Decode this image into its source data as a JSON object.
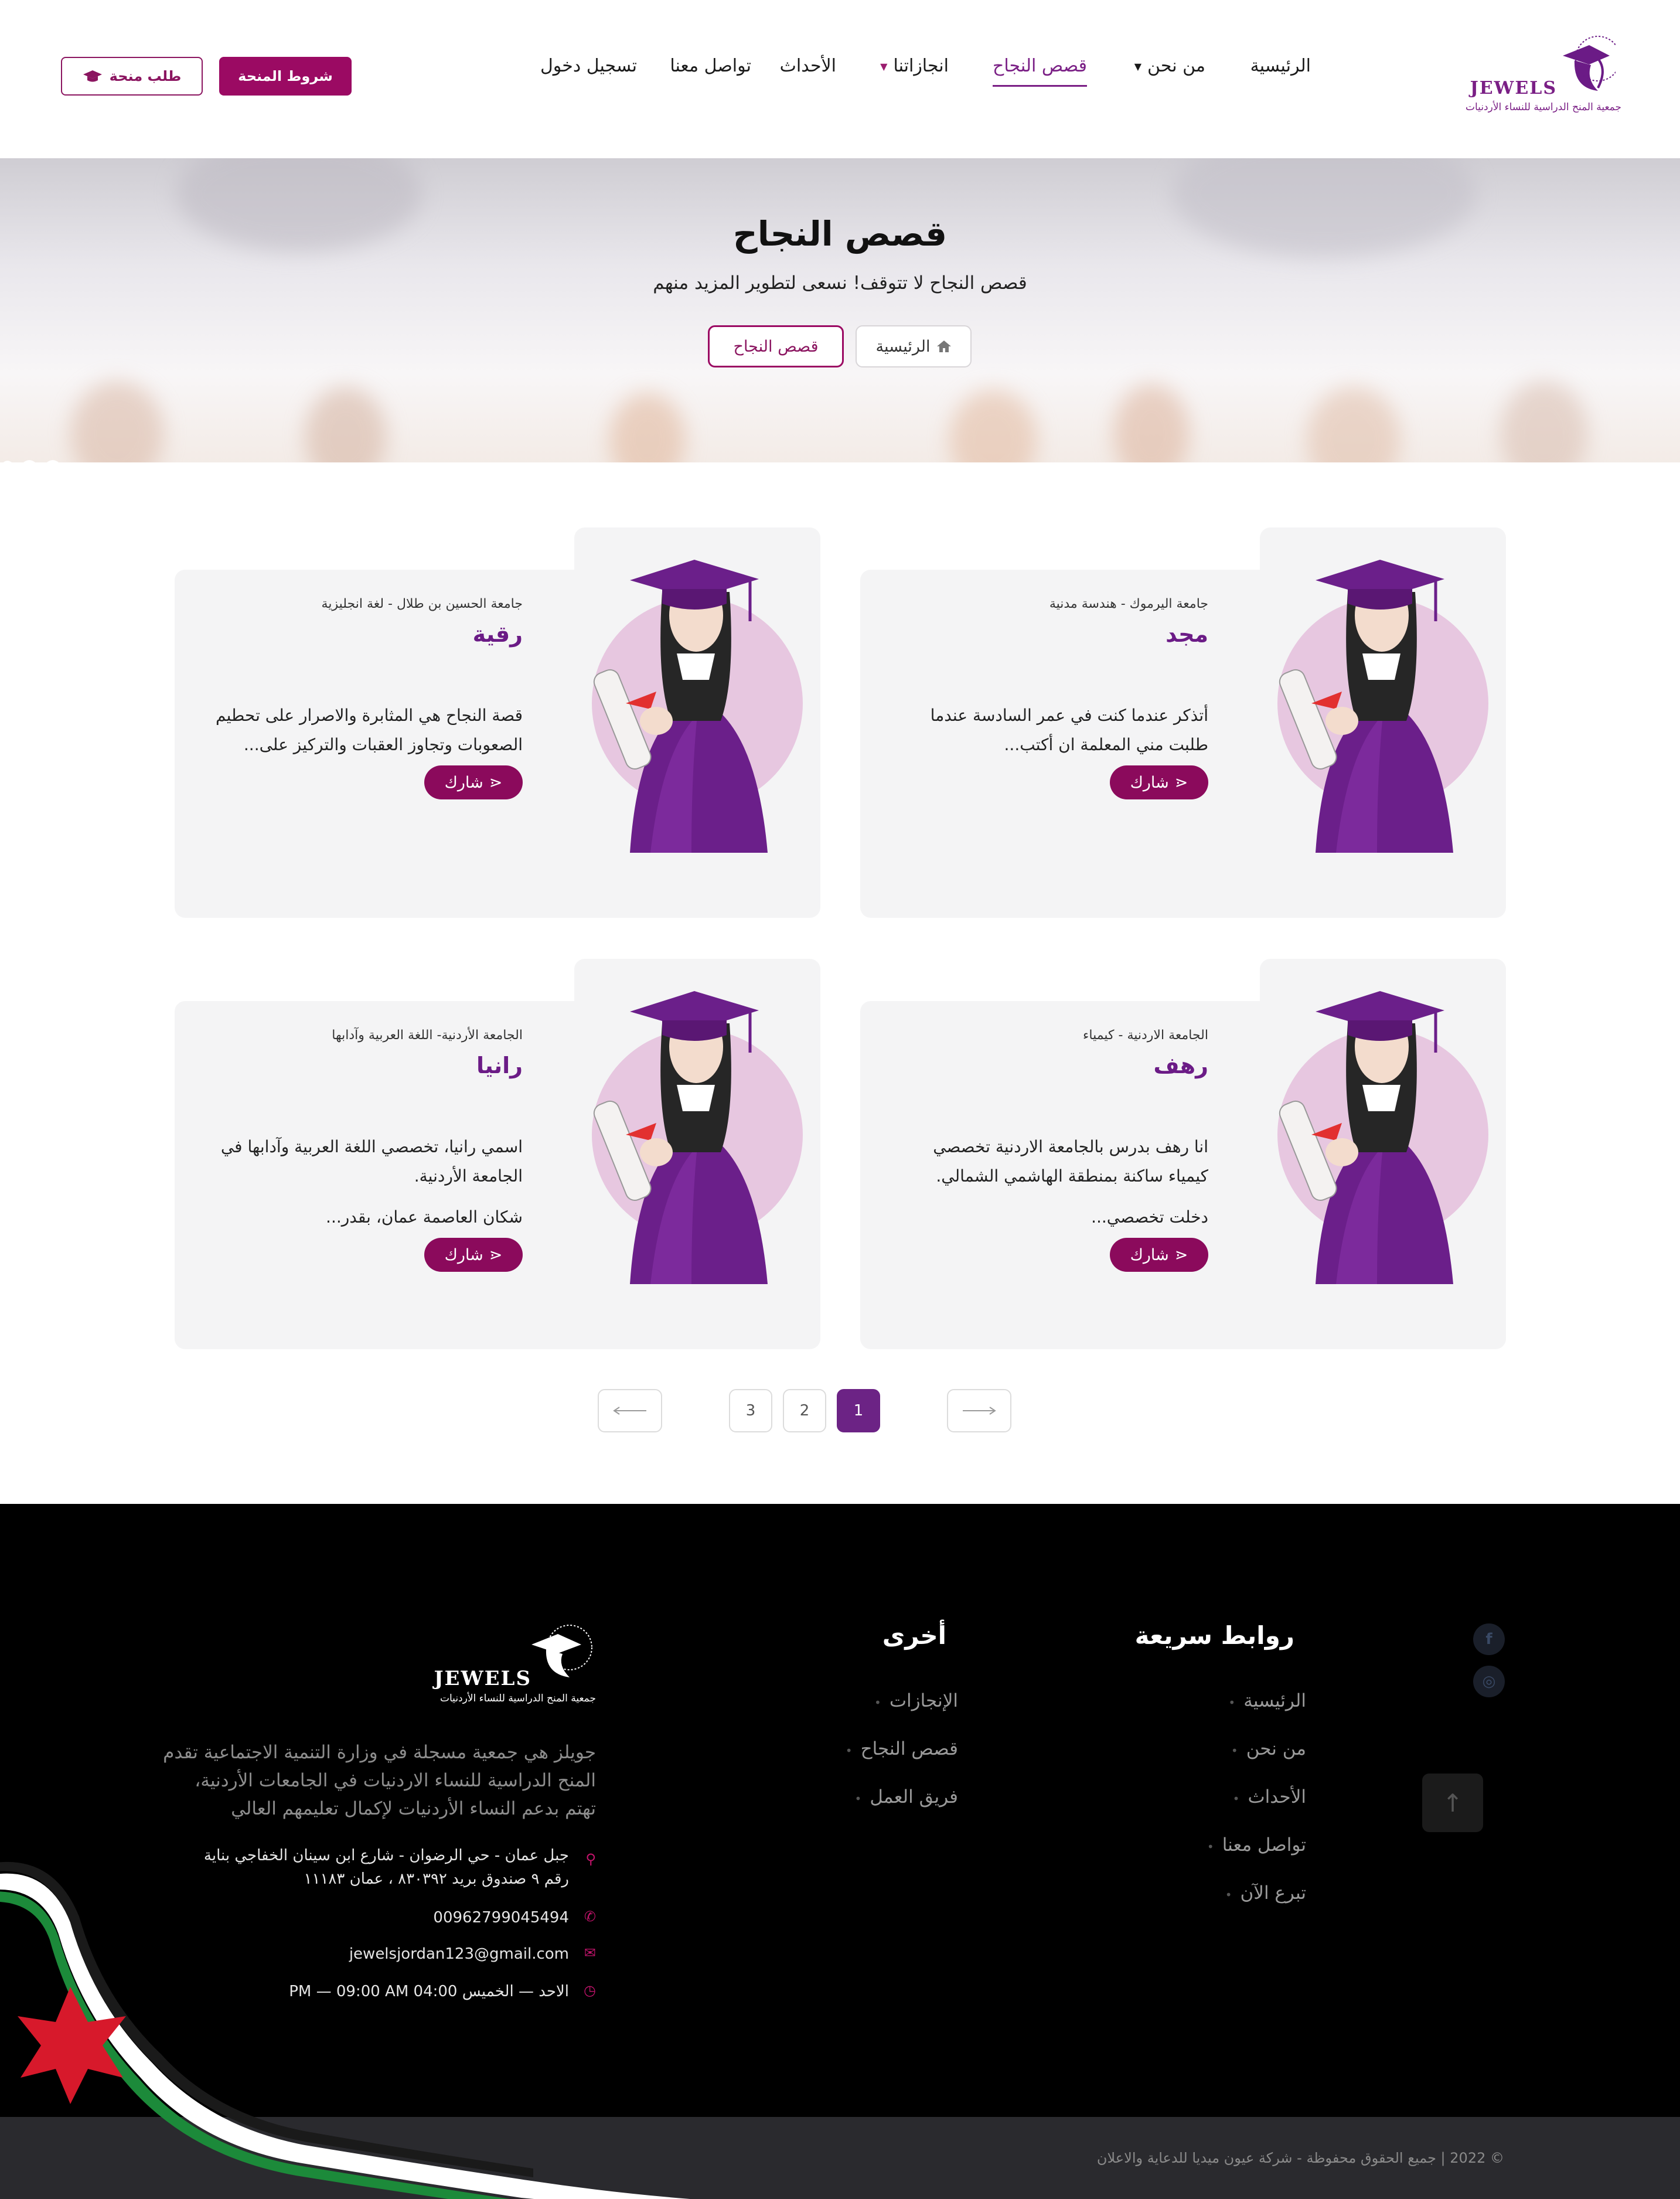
{
  "brand": {
    "logo_word": "JEWELS",
    "logo_sub": "جمعية المنح الدراسية للنساء الأردنيات"
  },
  "nav": {
    "items": [
      {
        "label": "الرئيسية"
      },
      {
        "label": "من نحن"
      },
      {
        "label": "قصص النجاح"
      },
      {
        "label": "انجازاتنا"
      },
      {
        "label": "الأحداث"
      },
      {
        "label": "تواصل معنا"
      },
      {
        "label": "تسجيل دخول"
      }
    ],
    "terms_button": "شروط المنحة",
    "apply_button": "طلب منحة"
  },
  "hero": {
    "title": "قصص النجاح",
    "subtitle": "قصص النجاح لا تتوقف! نسعى لتطوير المزيد منهم",
    "breadcrumb_home": "الرئيسية",
    "breadcrumb_current": "قصص النجاح"
  },
  "stories": [
    {
      "meta": "جامعة اليرموك - هندسة مدنية",
      "name": "مجد",
      "excerpt": [
        "أتذكر عندما كنت في عمر السادسة عندما",
        "طلبت مني المعلمة ان أكتب..."
      ],
      "share": "شارك"
    },
    {
      "meta": "جامعة الحسين بن طلال - لغة انجليزية",
      "name": "رقية",
      "excerpt": [
        "قصة النجاح هي المثابرة والاصرار على تحطيم",
        "الصعوبات وتجاوز العقبات والتركيز على..."
      ],
      "share": "شارك"
    },
    {
      "meta": "الجامعة الاردنية - كيمياء",
      "name": "رهف",
      "excerpt": [
        "انا رهف بدرس بالجامعة الاردنية تخصصي",
        "كيمياء ساكنة بمنطقة الهاشمي الشمالي.",
        "دخلت تخصصي..."
      ],
      "share": "شارك"
    },
    {
      "meta": "الجامعة الأردنية- اللغة العربية وآدابها",
      "name": "رانيا",
      "excerpt": [
        "اسمي رانيا، تخصصي اللغة العربية وآدابها في",
        "الجامعة الأردنية.",
        "شكان العاصمة عمان، بقدر..."
      ],
      "share": "شارك"
    }
  ],
  "pagination": {
    "pages": [
      "1",
      "2",
      "3"
    ],
    "current": "1",
    "prev_icon": "arrow-right-icon",
    "next_icon": "arrow-left-icon"
  },
  "footer": {
    "quick_links_title": "روابط سريعة",
    "quick_links": [
      "الرئيسية",
      "من نحن",
      "الأحداث",
      "تواصل معنا",
      "تبرع الآن"
    ],
    "other_title": "أخرى",
    "other_links": [
      "الإنجازات",
      "قصص النجاح",
      "فريق العمل"
    ],
    "description": "جويلز هي جمعية مسجلة في وزارة التنمية الاجتماعية تقدم المنح الدراسية للنساء الاردنيات في الجامعات الأردنية، تهتم بدعم النساء الأردنيات لإكمال تعليمهم العالي",
    "address_line1": "جبل عمان - حي الرضوان - شارع ابن سينان الخفاجي بناية",
    "address_line2": "رقم ٩ صندوق بريد ٨٣٠٣٩٢ ، عمان ١١١٨٣",
    "phone": "00962799045494",
    "email": "jewelsjordan123@gmail.com",
    "hours": "الاحد — الخميس 04:00 PM — 09:00 AM",
    "copyright": "© 2022 | جميع الحقوق محفوظة - شركة عيون ميديا للدعاية والاعلان",
    "social": [
      {
        "icon": "facebook-icon",
        "glyph": "f"
      },
      {
        "icon": "instagram-icon",
        "glyph": "◎"
      }
    ],
    "to_top_glyph": "↑"
  },
  "colors": {
    "brand_purple": "#7a1f85",
    "brand_magenta": "#9b0a63",
    "pagination_active": "#6c2385",
    "footer_bg": "#000000"
  }
}
